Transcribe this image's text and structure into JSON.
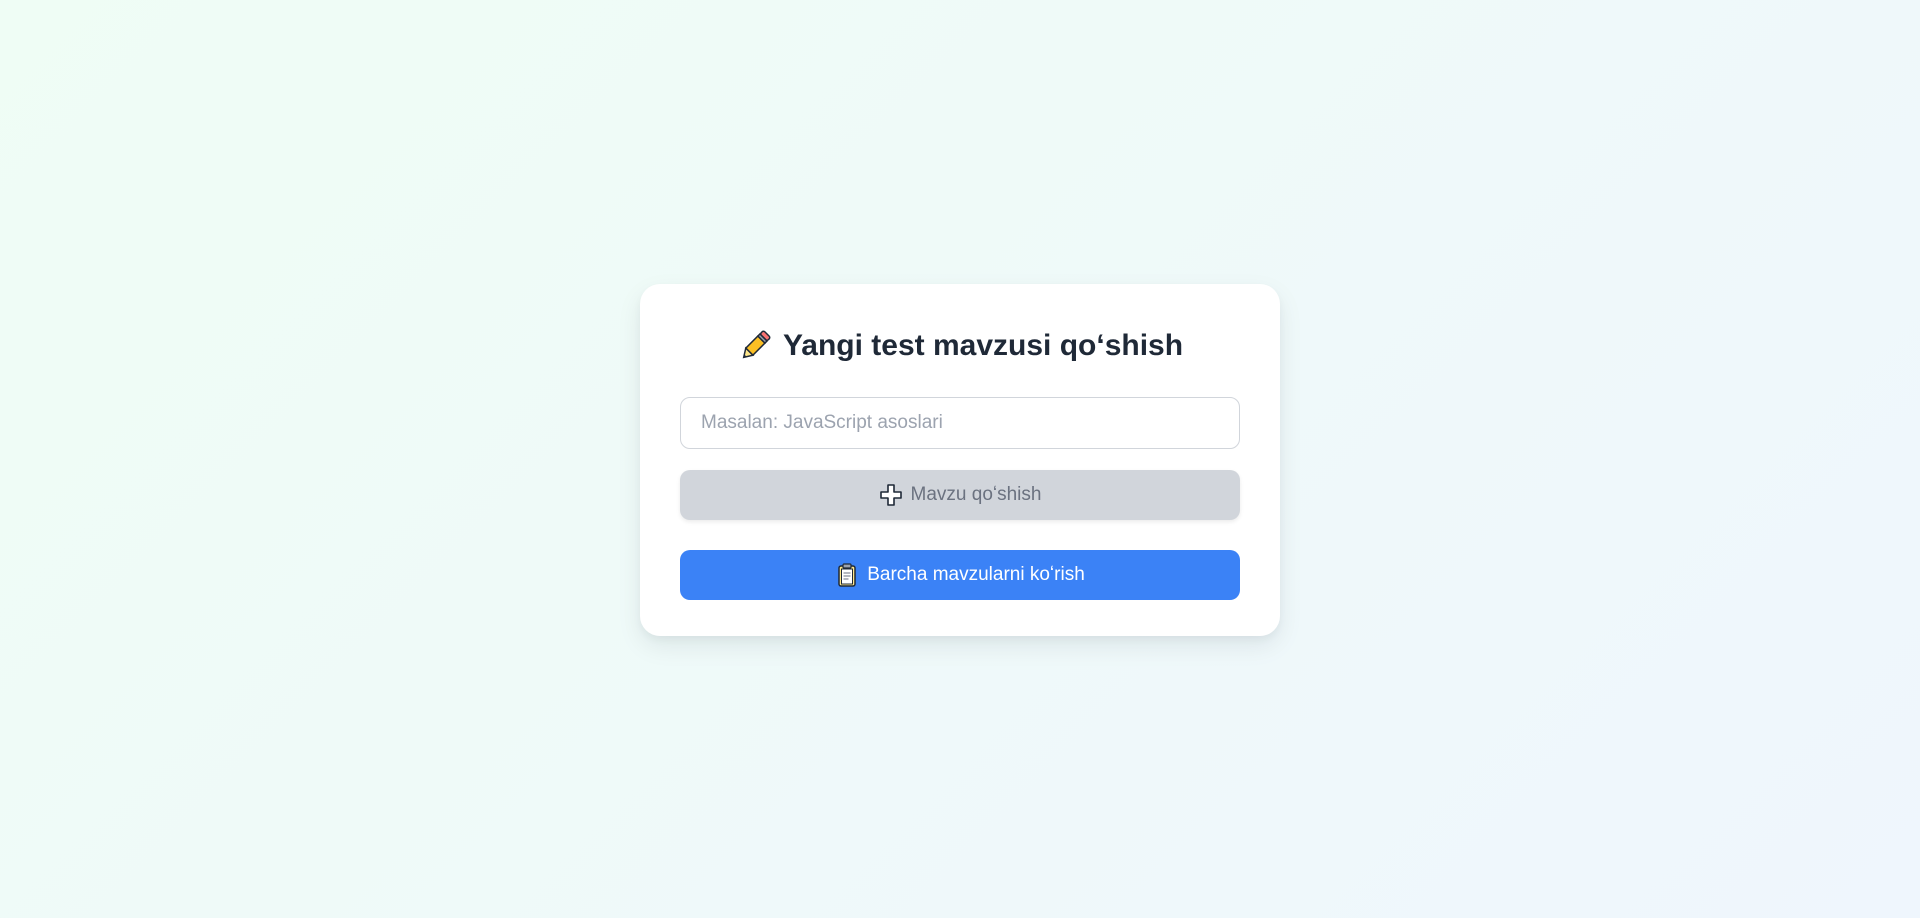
{
  "form": {
    "title": "Yangi test mavzusi qoʻshish",
    "title_icon": "pencil-icon",
    "input_placeholder": "Masalan: JavaScript asoslari",
    "input_value": "",
    "add_button_label": "Mavzu qoʻshish",
    "add_button_icon": "plus-icon",
    "view_all_label": "Barcha mavzularni koʻrish",
    "view_all_icon": "clipboard-icon"
  },
  "colors": {
    "primary": "#3b82f6",
    "disabled": "#d1d5db",
    "title": "#1f2937"
  }
}
